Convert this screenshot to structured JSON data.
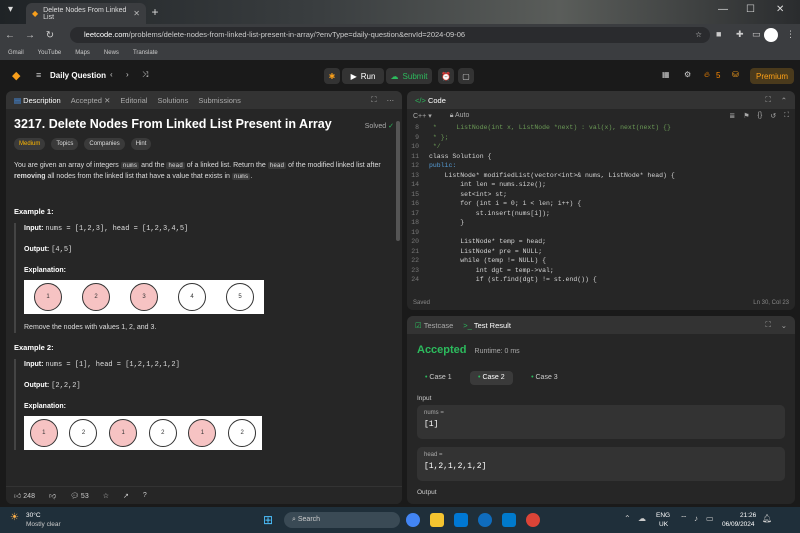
{
  "browser": {
    "tab_title": "Delete Nodes From Linked List",
    "url_domain": "leetcode.com",
    "url_path": "/problems/delete-nodes-from-linked-list-present-in-array/?envType=daily-question&envId=2024-09-06",
    "bookmarks": [
      "Gmail",
      "YouTube",
      "Maps",
      "News",
      "Translate"
    ]
  },
  "nav": {
    "daily": "Daily Question",
    "run": "Run",
    "submit": "Submit",
    "streak": "5",
    "premium": "Premium"
  },
  "desc": {
    "tabs": [
      "Description",
      "Accepted",
      "Editorial",
      "Solutions",
      "Submissions"
    ],
    "title": "3217. Delete Nodes From Linked List Present in Array",
    "solved": "Solved",
    "tags": [
      "Medium",
      "Topics",
      "Companies",
      "Hint"
    ],
    "p1a": "You are given an array of integers ",
    "c_nums": "nums",
    "p1b": " and the ",
    "c_head": "head",
    "p1c": " of a linked list. Return the ",
    "c_head2": "head",
    "p1d": " of the modified linked list after ",
    "p1e": "removing",
    "p1f": " all nodes from the linked list that have a value that exists in ",
    "c_nums2": "nums",
    "p1g": ".",
    "ex1": {
      "title": "Example 1:",
      "input_lbl": "Input:",
      "input": "nums = [1,2,3], head = [1,2,3,4,5]",
      "output_lbl": "Output:",
      "output": "[4,5]",
      "expl": "Explanation:",
      "note": "Remove the nodes with values 1, 2, and 3.",
      "nodes": [
        "1",
        "2",
        "3",
        "4",
        "5"
      ]
    },
    "ex2": {
      "title": "Example 2:",
      "input_lbl": "Input:",
      "input": "nums = [1], head = [1,2,1,2,1,2]",
      "output_lbl": "Output:",
      "output": "[2,2,2]",
      "expl": "Explanation:",
      "nodes": [
        "1",
        "2",
        "1",
        "2",
        "1",
        "2"
      ]
    },
    "likes": "248",
    "comments": "53"
  },
  "code": {
    "title": "Code",
    "lang": "C++",
    "auto": "Auto",
    "saved": "Saved",
    "pos": "Ln 30, Col 23",
    "lines": [
      {
        "n": "8",
        "t": " *     ListNode(int x, ListNode *next) : val(x), next(next) {}",
        "c": "cm"
      },
      {
        "n": "9",
        "t": " * };",
        "c": "cm"
      },
      {
        "n": "10",
        "t": " */",
        "c": "cm"
      },
      {
        "n": "11",
        "t": "class Solution {",
        "c": ""
      },
      {
        "n": "12",
        "t": "public:",
        "c": "kw"
      },
      {
        "n": "13",
        "t": "    ListNode* modifiedList(vector<int>& nums, ListNode* head) {",
        "c": ""
      },
      {
        "n": "14",
        "t": "        int len = nums.size();",
        "c": ""
      },
      {
        "n": "15",
        "t": "        set<int> st;",
        "c": ""
      },
      {
        "n": "16",
        "t": "        for (int i = 0; i < len; i++) {",
        "c": ""
      },
      {
        "n": "17",
        "t": "            st.insert(nums[i]);",
        "c": ""
      },
      {
        "n": "18",
        "t": "        }",
        "c": ""
      },
      {
        "n": "19",
        "t": "",
        "c": ""
      },
      {
        "n": "20",
        "t": "        ListNode* temp = head;",
        "c": ""
      },
      {
        "n": "21",
        "t": "        ListNode* pre = NULL;",
        "c": ""
      },
      {
        "n": "22",
        "t": "        while (temp != NULL) {",
        "c": ""
      },
      {
        "n": "23",
        "t": "            int dgt = temp->val;",
        "c": ""
      },
      {
        "n": "24",
        "t": "            if (st.find(dgt) != st.end()) {",
        "c": ""
      }
    ]
  },
  "result": {
    "tabs": [
      "Testcase",
      "Test Result"
    ],
    "status": "Accepted",
    "runtime": "Runtime: 0 ms",
    "cases": [
      "Case 1",
      "Case 2",
      "Case 3"
    ],
    "input_lbl": "Input",
    "f1k": "nums =",
    "f1v": "[1]",
    "f2k": "head =",
    "f2v": "[1,2,1,2,1,2]",
    "output_lbl": "Output"
  },
  "taskbar": {
    "temp": "30°C",
    "weather": "Mostly clear",
    "search": "Search",
    "lang1": "ENG",
    "lang2": "UK",
    "time": "21:26",
    "date": "06/09/2024"
  }
}
